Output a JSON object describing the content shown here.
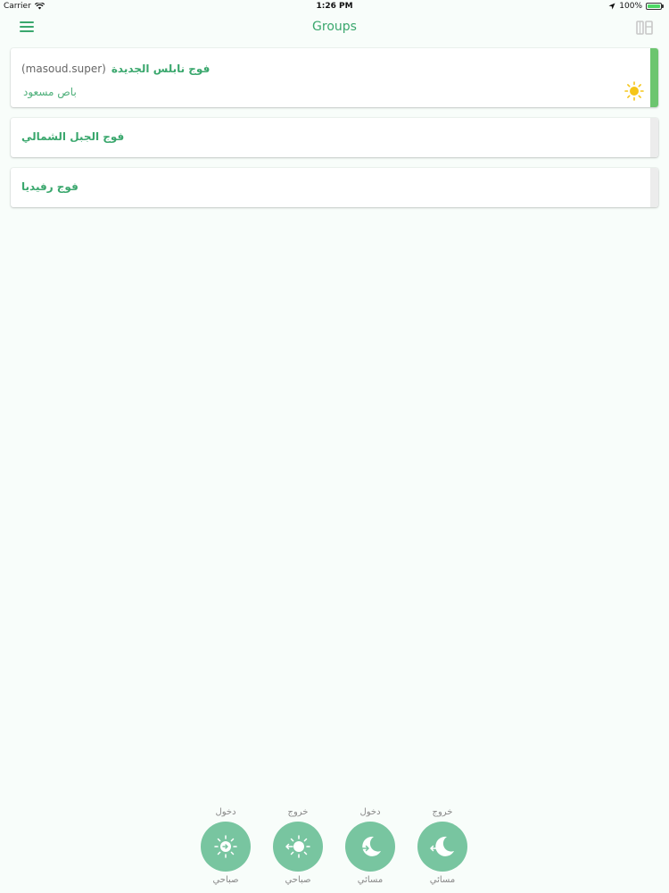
{
  "status_bar": {
    "carrier": "Carrier",
    "time": "1:26 PM",
    "battery": "100%"
  },
  "nav": {
    "title": "Groups",
    "menu_icon": "hamburger-menu-icon",
    "right_icon": "pages-icon"
  },
  "groups": [
    {
      "name": "فوج نابلس الجديدة",
      "user": "(masoud.super)",
      "subtitle": "باص مسعود",
      "active": true,
      "icon": "sun-icon"
    },
    {
      "name": "فوج الجبل الشمالي",
      "active": false
    },
    {
      "name": "فوج رفيديا",
      "active": false
    }
  ],
  "actions": [
    {
      "top": "دخول",
      "bottom": "صباحي",
      "icon": "sun-enter-icon"
    },
    {
      "top": "خروج",
      "bottom": "صباحي",
      "icon": "sun-exit-icon"
    },
    {
      "top": "دخول",
      "bottom": "مسائي",
      "icon": "moon-enter-icon"
    },
    {
      "top": "خروج",
      "bottom": "مسائي",
      "icon": "moon-exit-icon"
    }
  ],
  "colors": {
    "accent": "#3aa76d",
    "button": "#78c5a0",
    "active_bar": "#6cc56f",
    "sun": "#f5c518"
  }
}
